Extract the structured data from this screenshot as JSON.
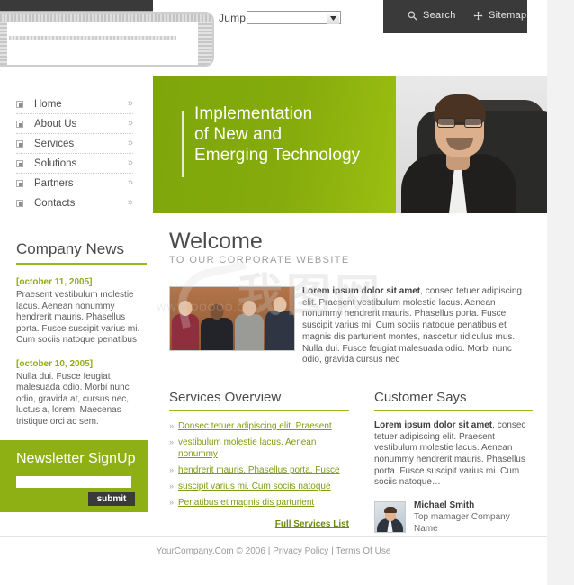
{
  "topbar": {
    "jump_label": "Jump",
    "jump_selected": "",
    "search_label": "Search",
    "sitemap_label": "Sitemap",
    "search_icon": "magnifier-icon",
    "sitemap_icon": "sitemap-cross-icon"
  },
  "nav": {
    "items": [
      {
        "label": "Home",
        "chevron": "»"
      },
      {
        "label": "About Us",
        "chevron": "»"
      },
      {
        "label": "Services",
        "chevron": "»"
      },
      {
        "label": "Solutions",
        "chevron": "»"
      },
      {
        "label": "Partners",
        "chevron": "»"
      },
      {
        "label": "Contacts",
        "chevron": "»"
      }
    ]
  },
  "hero": {
    "line1": "Implementation",
    "line2": "of New and",
    "line3": "Emerging Technology",
    "image_alt": "businessman-portrait"
  },
  "news": {
    "heading": "Company News",
    "items": [
      {
        "date": "[october 11, 2005]",
        "body": "Praesent vestibulum molestie lacus. Aenean nonummy hendrerit mauris. Phasellus porta. Fusce suscipit varius mi. Cum sociis natoque penatibus"
      },
      {
        "date": "[october 10, 2005]",
        "body": "Nulla dui. Fusce feugiat malesuada odio. Morbi nunc odio, gravida at, cursus nec, luctus a, lorem. Maecenas tristique orci ac sem."
      }
    ]
  },
  "newsletter": {
    "title": "Newsletter SignUp",
    "input_value": "",
    "input_placeholder": "",
    "submit_label": "submit"
  },
  "welcome": {
    "heading": "Welcome",
    "subheading": "TO OUR CORPORATE WEBSITE",
    "photo_alt": "business-team-photo",
    "lead": "Lorem ipsum dolor sit amet",
    "body": ", consec tetuer adipiscing elit. Praesent vestibulum molestie lacus. Aenean nonummy hendrerit mauris. Phasellus porta. Fusce suscipit varius mi. Cum sociis natoque penatibus et magnis dis parturient montes, nascetur ridiculus mus. Nulla dui. Fusce feugiat malesuada odio. Morbi nunc odio, gravida cursus nec"
  },
  "services": {
    "heading": "Services Overview",
    "links": [
      "Donsec tetuer adipiscing elit. Praesent",
      "vestibulum molestie lacus. Aenean nonummy",
      "hendrerit mauris. Phasellus porta. Fusce",
      "suscipit varius mi. Cum sociis natoque",
      "Penatibus et magnis dis parturient"
    ],
    "chevron": "»",
    "full_list_label": "Full Services List"
  },
  "customer": {
    "heading": "Customer Says",
    "quote_lead": "Lorem ipsum dolor sit amet",
    "quote_body": ", consec tetuer adipiscing elit. Praesent vestibulum molestie lacus. Aenean nonummy hendrerit mauris. Phasellus porta. Fusce suscipit varius mi. Cum sociis natoque…",
    "name": "Michael Smith",
    "role": "Top mamager Company Name",
    "avatar_alt": "customer-avatar"
  },
  "footer": {
    "text": "YourCompany.Com © 2006 | Privacy Policy | Terms Of Use"
  },
  "watermark": {
    "text": "我图网",
    "url": "WWW.OOOOO.COM"
  },
  "colors": {
    "green": "#8fb014",
    "green_dark": "#7ea60b",
    "green_light": "#b4d61c",
    "dark_bar": "#3a3a3a",
    "link_green": "#7f9c12",
    "text_gray": "#5a5a5a"
  }
}
